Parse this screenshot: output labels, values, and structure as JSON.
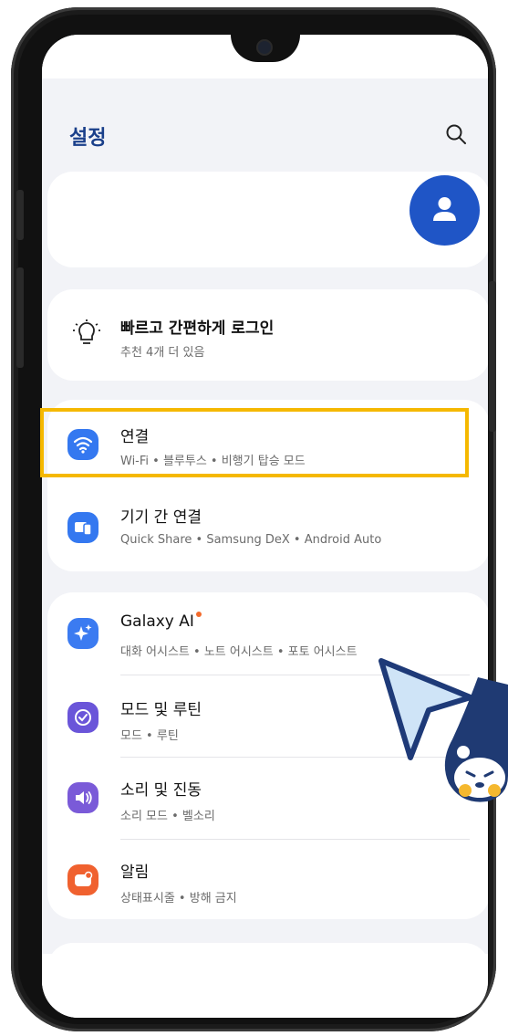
{
  "header": {
    "title": "설정",
    "search_icon": "search-icon"
  },
  "login": {
    "title": "빠르고 간편하게 로그인",
    "subtitle": "추천 4개 더 있음",
    "icon": "lightbulb-icon"
  },
  "connections": [
    {
      "title": "연결",
      "subtitle": "Wi-Fi • 블루투스 • 비행기 탑승 모드",
      "icon": "wifi-icon",
      "color": "#3478f0"
    },
    {
      "title": "기기 간 연결",
      "subtitle": "Quick Share • Samsung DeX • Android Auto",
      "icon": "devices-icon",
      "color": "#3478f0"
    }
  ],
  "main_items": [
    {
      "title": "Galaxy AI",
      "subtitle": "대화 어시스트 • 노트 어시스트 • 포토 어시스트",
      "icon": "sparkle-icon",
      "color": "#3b7bf1"
    },
    {
      "title": "모드 및 루틴",
      "subtitle": "모드 • 루틴",
      "icon": "check-circle-icon",
      "color": "#6a55d9"
    },
    {
      "title": "소리 및 진동",
      "subtitle": "소리 모드 • 벨소리",
      "icon": "speaker-icon",
      "color": "#7a5ad8"
    },
    {
      "title": "알림",
      "subtitle": "상태표시줄 • 방해 금지",
      "icon": "notification-icon",
      "color": "#f0612f"
    }
  ],
  "colors": {
    "accent": "#1a3f8a",
    "avatar": "#1f55c6",
    "highlight": "#f5b800",
    "badge": "#f36b2c"
  }
}
